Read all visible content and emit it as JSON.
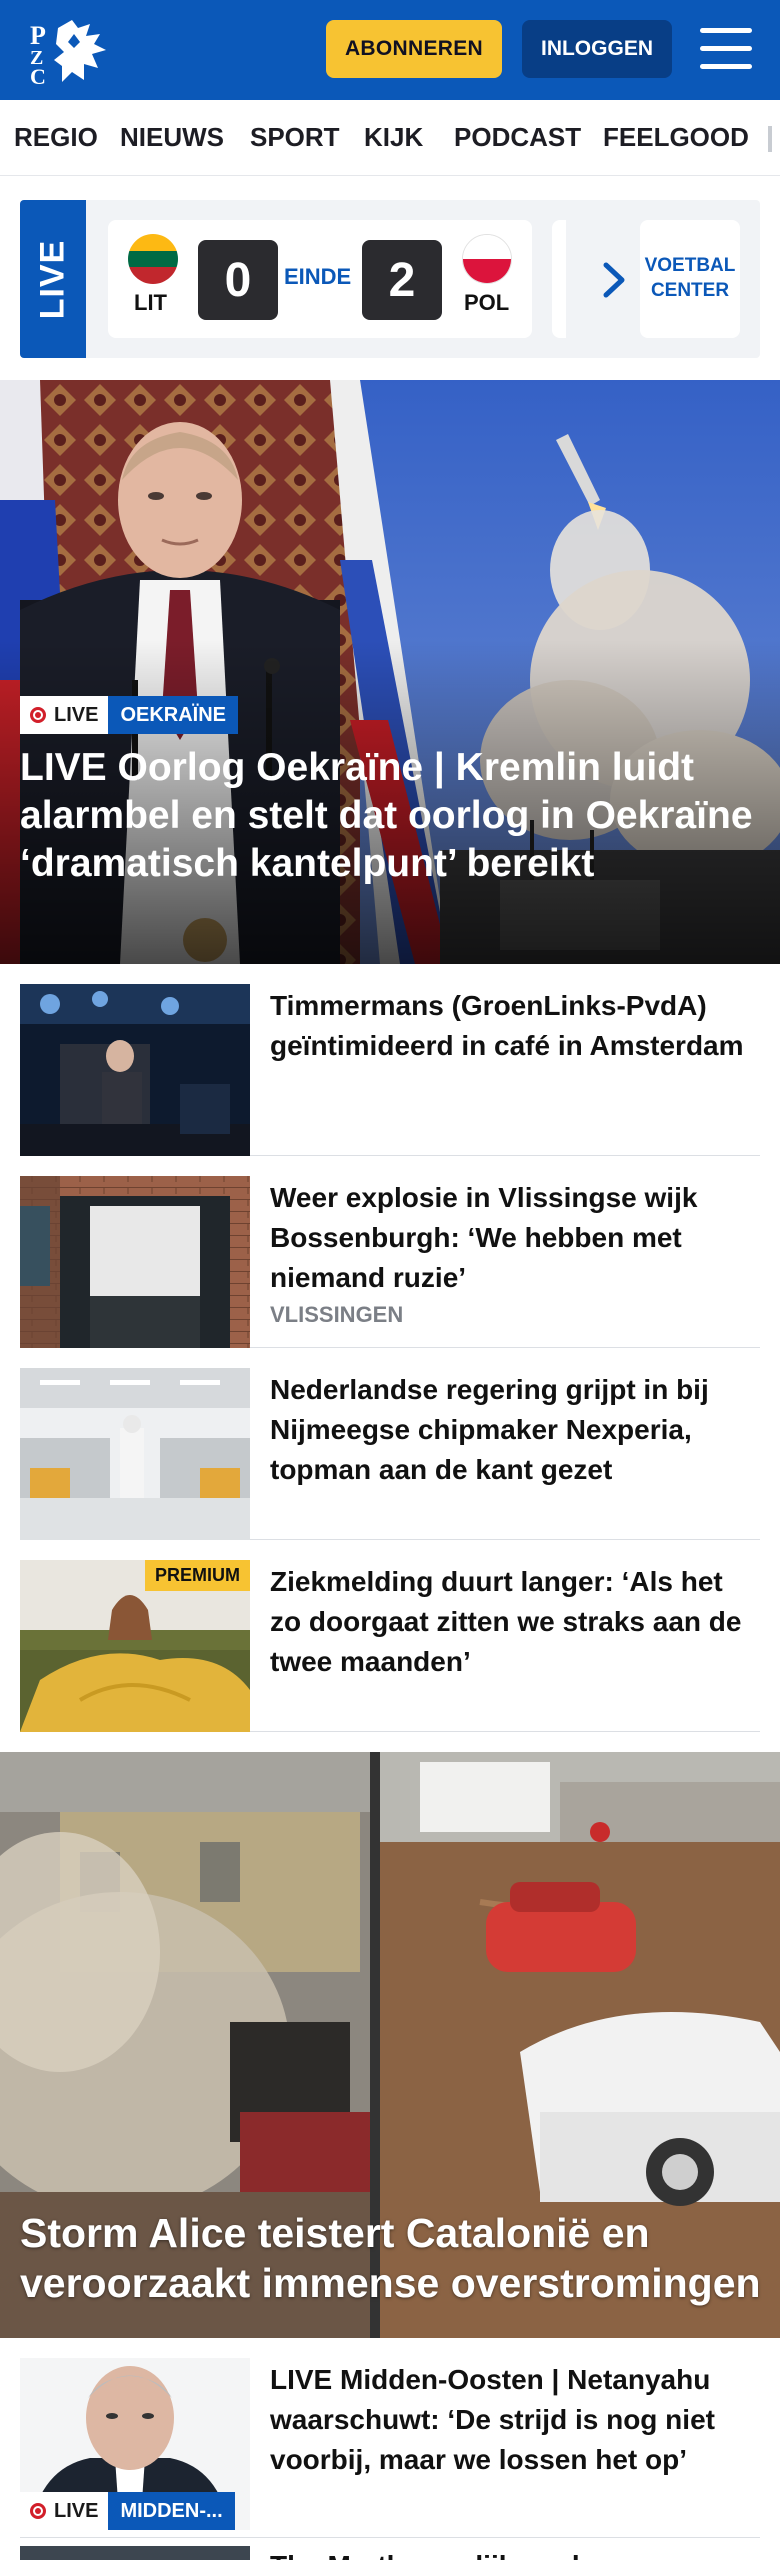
{
  "header": {
    "logo_text": "PZC",
    "subscribe_label": "ABONNEREN",
    "login_label": "INLOGGEN",
    "colors": {
      "brand": "#0b58b8",
      "accent": "#f7c332"
    }
  },
  "nav": {
    "items": [
      "REGIO",
      "NIEUWS",
      "SPORT",
      "KIJK",
      "PODCAST",
      "FEELGOOD"
    ]
  },
  "scores": {
    "live_label": "LIVE",
    "match": {
      "home_code": "LIT",
      "home_score": "0",
      "status": "EINDE",
      "away_score": "2",
      "away_code": "POL"
    },
    "center_label_1": "VOETBAL",
    "center_label_2": "CENTER"
  },
  "hero": {
    "live_label": "LIVE",
    "category": "OEKRAÏNE",
    "title": "LIVE Oorlog Oekraïne | Kremlin luidt alarmbel en stelt dat oorlog in Oekraïne ‘dramatisch kantelpunt’ bereikt"
  },
  "articles": [
    {
      "title": "Timmermans (GroenLinks-PvdA) geïntimideerd in café in Amsterdam",
      "meta": ""
    },
    {
      "title": "Weer explosie in Vlissingse wijk Bossenburgh: ‘We hebben met niemand ruzie’",
      "meta": "VLISSINGEN"
    },
    {
      "title": "Nederlandse regering grijpt in bij Nijmeegse chipmaker Nexperia, topman aan de kant gezet",
      "meta": ""
    },
    {
      "title": "Ziekmelding duurt langer: ‘Als het zo doorgaat zitten we straks aan de twee maanden’",
      "meta": "",
      "badge": "PREMIUM"
    }
  ],
  "storm": {
    "title": "Storm Alice teistert Catalonië en veroorzaakt immense overstromingen"
  },
  "bottom_article": {
    "live_label": "LIVE",
    "category": "MIDDEN-...",
    "title": "LIVE Midden-Oosten | Netanyahu waarschuwt: ‘De strijd is nog niet voorbij, maar we lossen het op’"
  },
  "partial_article": {
    "title": "The Marthas gelijk en de bestaande..."
  }
}
